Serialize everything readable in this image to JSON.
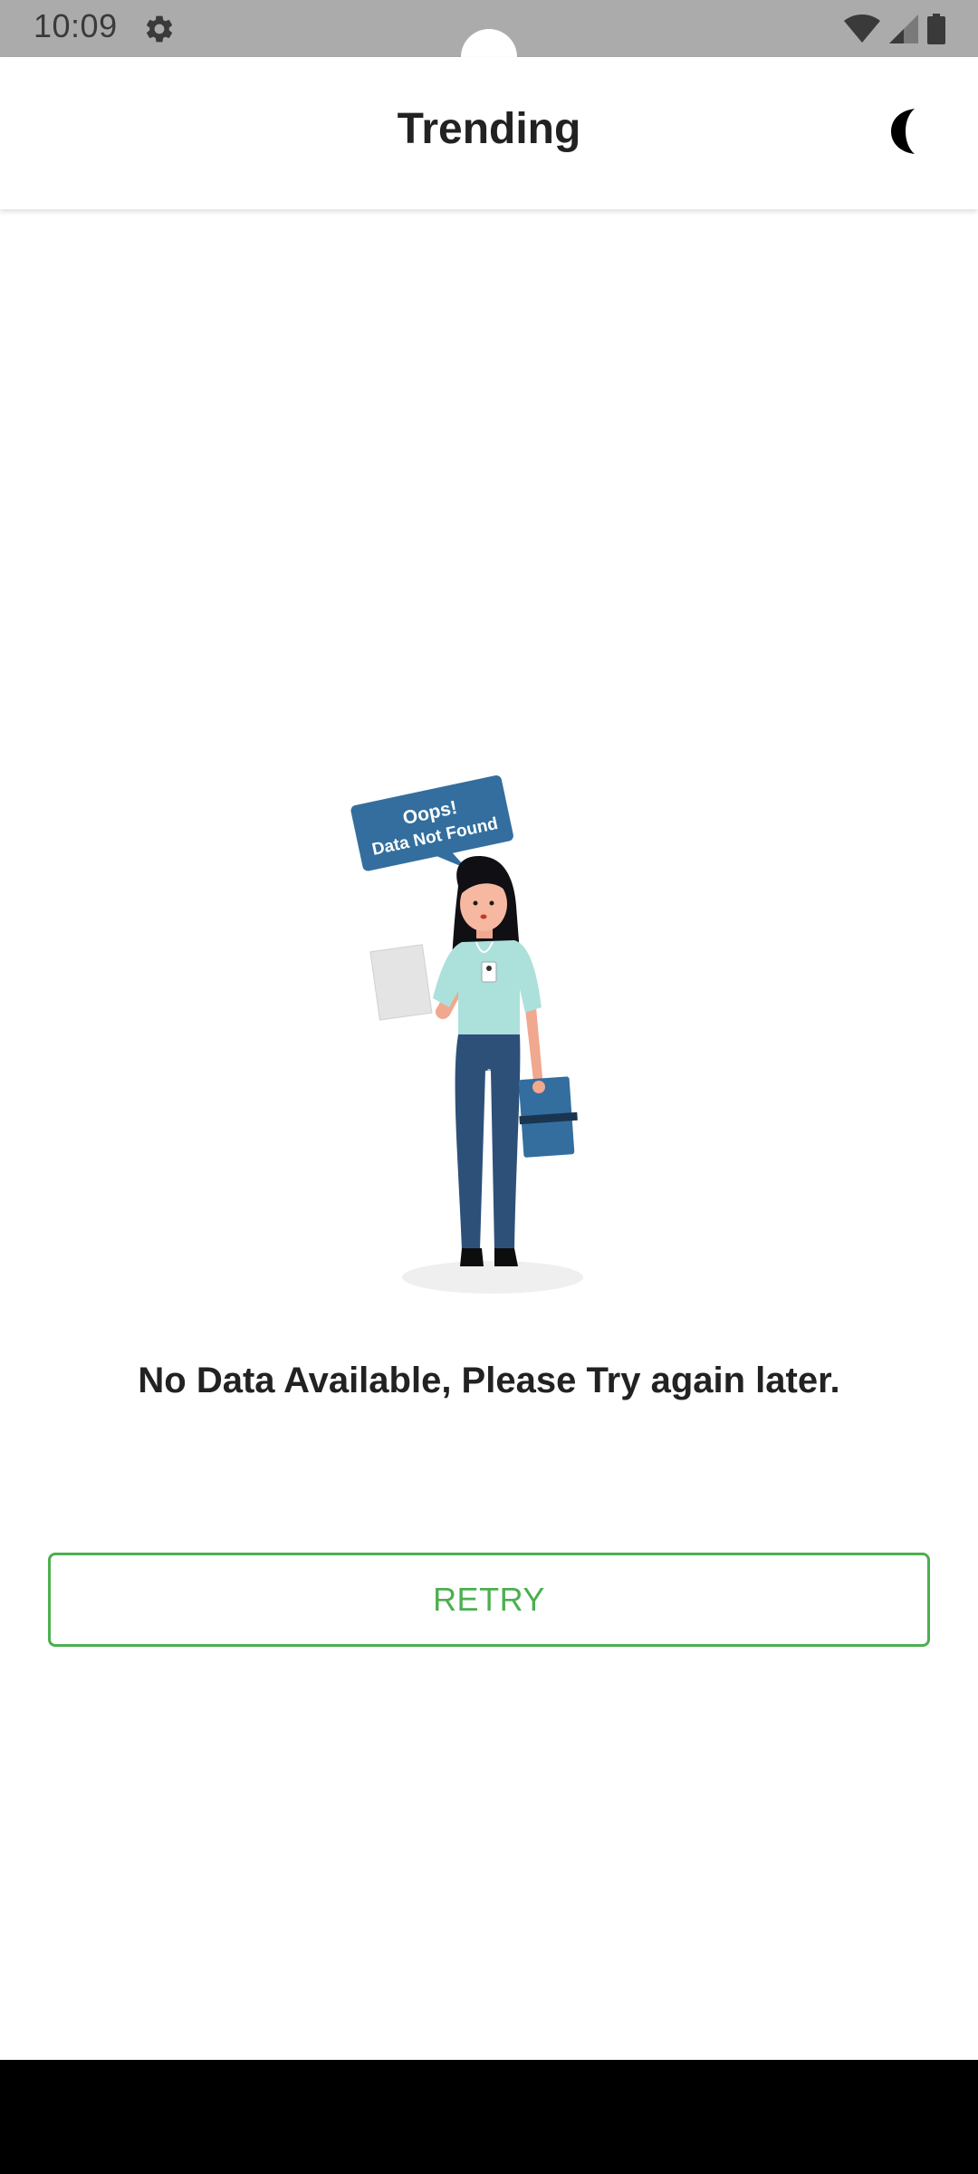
{
  "status_bar": {
    "time": "10:09",
    "icons": [
      "settings-gear-icon",
      "wifi-icon",
      "signal-icon",
      "battery-icon"
    ]
  },
  "app_bar": {
    "title": "Trending",
    "theme_icon": "moon-icon"
  },
  "empty_state": {
    "illustration_bubble_line1": "Oops!",
    "illustration_bubble_line2": "Data Not Found",
    "message": "No Data Available, Please Try again later."
  },
  "retry_button": {
    "label": "RETRY"
  },
  "colors": {
    "accent": "#4caf50",
    "status_bar": "#ababab",
    "bubble": "#336e9e",
    "nav_bar": "#000000"
  }
}
